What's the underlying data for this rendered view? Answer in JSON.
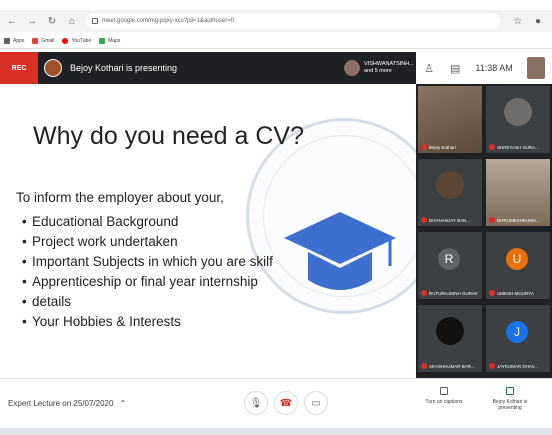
{
  "browser": {
    "url": "meet.google.com/mg-pqxy-xcs?pli=1&authuser=0",
    "bookmarks": [
      "Apps",
      "Gmail",
      "YouTube",
      "Maps"
    ]
  },
  "meet": {
    "rec_label": "REC",
    "presenter_text": "Bejoy Kothari is presenting",
    "viewer_text": "VISHWANATSINH... and 5 more",
    "clock": "11:38 AM"
  },
  "slide": {
    "title": "Why do you need a CV?",
    "intro": "To inform the employer about your,",
    "bullets": [
      "Educational Background",
      "Project work undertaken",
      "Important Subjects in which you are skilf",
      "Apprenticeship or final year internship",
      "details",
      "Your Hobbies & Interests"
    ]
  },
  "participants": [
    {
      "name": "Bejoy Kothari",
      "kind": "video",
      "color": "#6b5a45"
    },
    {
      "name": "SHREYASH SURA...",
      "kind": "photo",
      "color": "#4a4a4a"
    },
    {
      "name": "DHANANJAY BAN...",
      "kind": "photo",
      "color": "#2f2f2f"
    },
    {
      "name": "DHRUMESHKUMA...",
      "kind": "video",
      "color": "#7a6a5a"
    },
    {
      "name": "RUTURAJSINH GURAV",
      "kind": "letter",
      "letter": "R",
      "color": "#5f6368"
    },
    {
      "name": "UMESH MOURYA",
      "kind": "letter",
      "letter": "U",
      "color": "#e8710a"
    },
    {
      "name": "AKASHKUMAR BAR...",
      "kind": "photo",
      "color": "#222222"
    },
    {
      "name": "JAYKUMAR DHAV...",
      "kind": "letter",
      "letter": "J",
      "color": "#1a73e8"
    }
  ],
  "bottom": {
    "meeting_label": "Expert Lecture on 25/07/2020",
    "captions_label": "Turn on captions",
    "present_label": "Bejoy Kothari is presenting"
  },
  "colors": {
    "rec": "#d93025",
    "cap_blue": "#3c6fcf",
    "end_call": "#d93025"
  }
}
